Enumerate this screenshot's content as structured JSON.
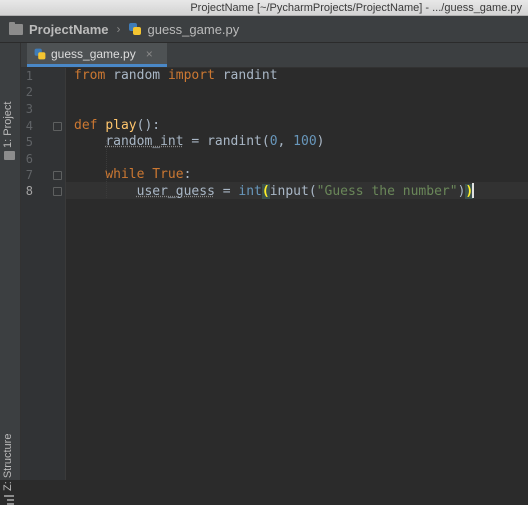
{
  "window": {
    "title": "ProjectName [~/PycharmProjects/ProjectName] - .../guess_game.py"
  },
  "navbar": {
    "project": "ProjectName",
    "separator": "›",
    "file": "guess_game.py",
    "folder_icon": "folder-icon",
    "file_icon": "python-file-icon"
  },
  "tool_windows": {
    "project": "1: Project",
    "structure": "Z: Structure"
  },
  "tabs": [
    {
      "label": "guess_game.py",
      "close": "×",
      "active": true
    }
  ],
  "editor": {
    "current_line": 8,
    "line_numbers": [
      "1",
      "2",
      "3",
      "4",
      "5",
      "6",
      "7",
      "8"
    ],
    "code": {
      "l1": {
        "kw1": "from",
        "mod": " random ",
        "kw2": "import",
        "name": " randint"
      },
      "l4": {
        "kw": "def",
        "sp": " ",
        "fn": "play",
        "rest": "():"
      },
      "l5": {
        "indent": "    ",
        "var": "random_int",
        "eq": " = randint(",
        "n0": "0",
        "comma": ", ",
        "n100": "100",
        "close": ")"
      },
      "l7": {
        "indent": "    ",
        "kw": "while",
        "sp": " ",
        "kw2": "True",
        "colon": ":"
      },
      "l8": {
        "indent": "        ",
        "var": "user_guess",
        "eq": " = ",
        "fn": "int",
        "paren_open": "(",
        "inner": "input(",
        "str": "\"Guess the number\"",
        "inner_close": ")",
        "paren_close": ")"
      }
    },
    "colors": {
      "background": "#2b2b2b",
      "keyword": "#cc7832",
      "function": "#ffc66d",
      "number": "#6897bb",
      "string": "#6a8759",
      "text": "#a9b7c6"
    }
  }
}
